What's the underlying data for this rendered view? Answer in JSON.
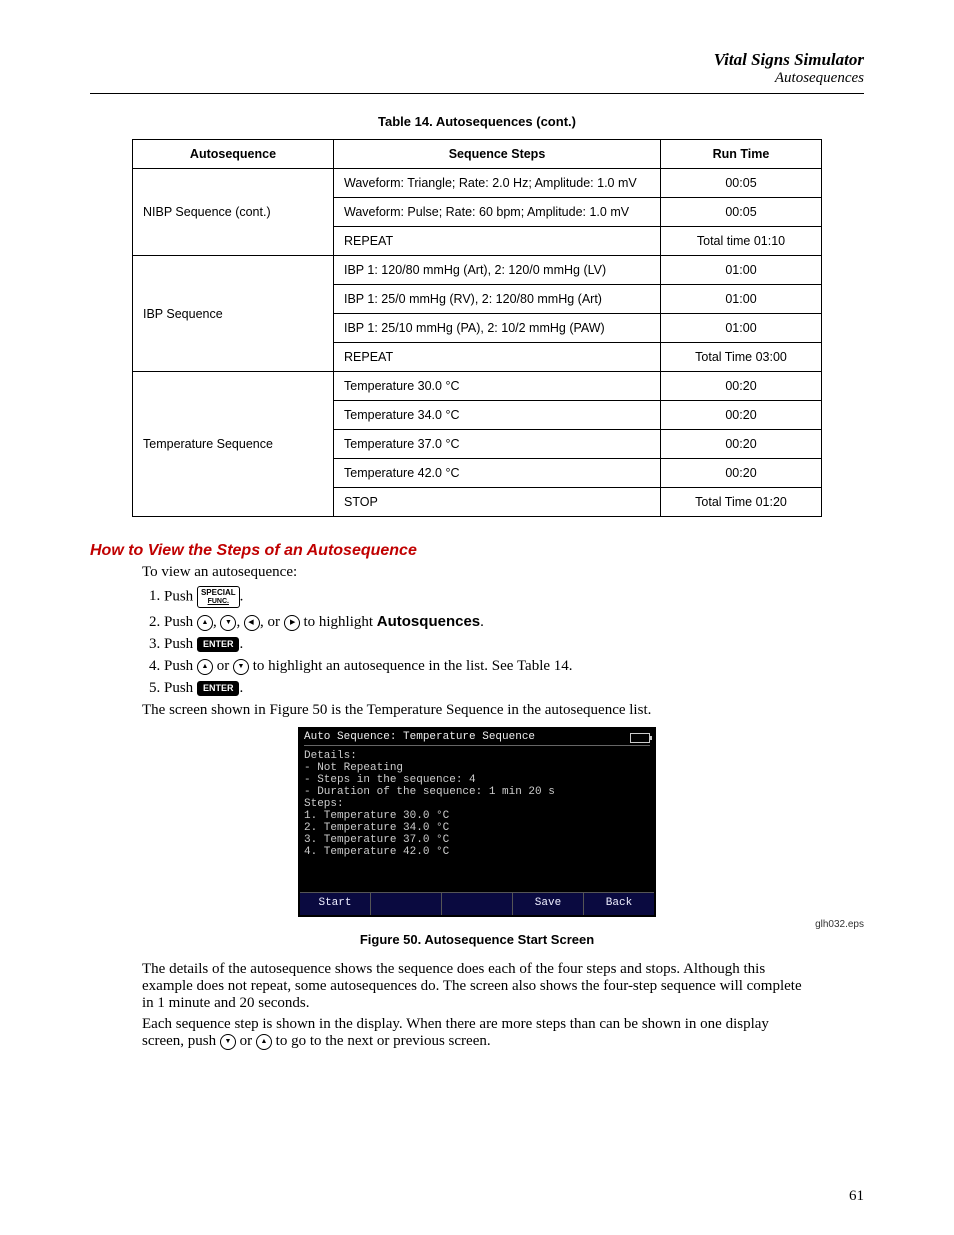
{
  "header": {
    "title": "Vital Signs Simulator",
    "subtitle": "Autosequences"
  },
  "table": {
    "caption": "Table 14. Autosequences (cont.)",
    "headers": {
      "c1": "Autosequence",
      "c2": "Sequence Steps",
      "c3": "Run Time"
    },
    "groups": [
      {
        "name": "NIBP Sequence (cont.)",
        "rows": [
          {
            "step": "Waveform: Triangle; Rate: 2.0 Hz; Amplitude: 1.0 mV",
            "time": "00:05"
          },
          {
            "step": "Waveform: Pulse; Rate: 60 bpm; Amplitude: 1.0 mV",
            "time": "00:05"
          },
          {
            "step": "REPEAT",
            "time": "Total time 01:10"
          }
        ]
      },
      {
        "name": "IBP Sequence",
        "rows": [
          {
            "step": "IBP 1: 120/80 mmHg (Art), 2: 120/0 mmHg (LV)",
            "time": "01:00"
          },
          {
            "step": "IBP 1: 25/0 mmHg (RV), 2: 120/80 mmHg (Art)",
            "time": "01:00"
          },
          {
            "step": "IBP 1: 25/10 mmHg (PA), 2: 10/2 mmHg (PAW)",
            "time": "01:00"
          },
          {
            "step": "REPEAT",
            "time": "Total Time 03:00"
          }
        ]
      },
      {
        "name": "Temperature Sequence",
        "rows": [
          {
            "step": "Temperature 30.0 °C",
            "time": "00:20"
          },
          {
            "step": "Temperature 34.0 °C",
            "time": "00:20"
          },
          {
            "step": "Temperature 37.0 °C",
            "time": "00:20"
          },
          {
            "step": "Temperature 42.0 °C",
            "time": "00:20"
          },
          {
            "step": "STOP",
            "time": "Total Time 01:20"
          }
        ]
      }
    ]
  },
  "section": {
    "heading": "How to View the Steps of an Autosequence",
    "intro": "To view an autosequence:",
    "steps": {
      "s1a": "Push ",
      "s1b": ".",
      "s2a": "Push ",
      "s2b": ", ",
      "s2c": ", ",
      "s2d": ", or ",
      "s2e": " to highlight ",
      "s2f": "Autosquences",
      "s2g": ".",
      "s3a": "Push ",
      "s3b": ".",
      "s4a": "Push ",
      "s4b": " or ",
      "s4c": " to highlight an autosequence in the list. See Table 14.",
      "s5a": "Push ",
      "s5b": "."
    },
    "special_key_line1": "SPECIAL",
    "special_key_line2": "FUNC.",
    "enter_key": "ENTER",
    "after_steps": "The screen shown in Figure 50 is the Temperature Sequence in the autosequence list."
  },
  "lcd": {
    "title": "Auto Sequence: Temperature Sequence",
    "lines": [
      "Details:",
      "- Not Repeating",
      "- Steps in the sequence: 4",
      "- Duration of the sequence: 1 min 20 s",
      "Steps:",
      "1. Temperature 30.0 °C",
      "2. Temperature 34.0 °C",
      "3. Temperature 37.0 °C",
      "4. Temperature 42.0 °C"
    ],
    "softkeys": {
      "k1": "Start",
      "k2": "",
      "k3": "",
      "k4": "Save",
      "k5": "Back"
    },
    "eps": "glh032.eps"
  },
  "figure_caption": "Figure 50. Autosequence Start Screen",
  "para1": "The details of the autosequence shows the sequence does each of the four steps and stops. Although this example does not repeat, some autosequences do. The screen also shows the four-step sequence will complete in 1 minute and 20 seconds.",
  "para2a": "Each sequence step is shown in the display. When there are more steps than can be shown in one display screen, push ",
  "para2b": " or ",
  "para2c": " to go to the next or previous screen.",
  "page_number": "61"
}
